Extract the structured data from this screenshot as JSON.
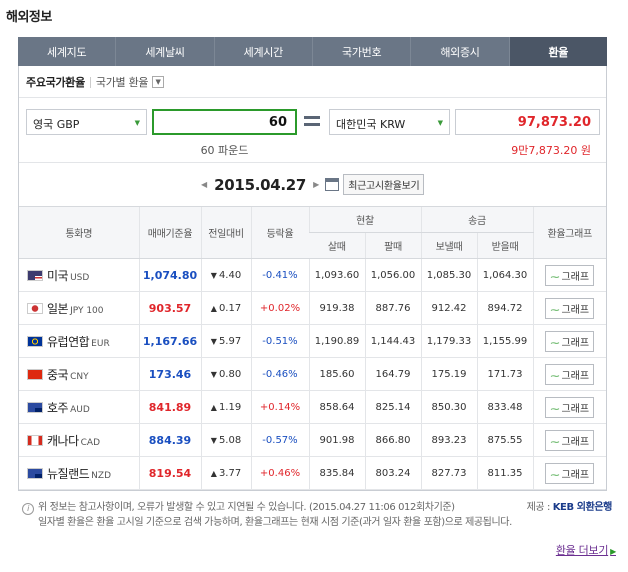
{
  "section_title": "해외정보",
  "tabs": [
    {
      "label": "세계지도",
      "active": false
    },
    {
      "label": "세계날씨",
      "active": false
    },
    {
      "label": "세계시간",
      "active": false
    },
    {
      "label": "국가번호",
      "active": false
    },
    {
      "label": "해외증시",
      "active": false
    },
    {
      "label": "환율",
      "active": true
    }
  ],
  "subtabs": {
    "main": "주요국가환율",
    "other": "국가별 환율"
  },
  "converter": {
    "from_currency": "영국 GBP",
    "amount": "60",
    "from_caption": "60 파운드",
    "to_currency": "대한민국 KRW",
    "result": "97,873.20",
    "result_caption": "9만7,873.20 원"
  },
  "date_nav": {
    "date": "2015.04.27",
    "latest_button": "최근고시환율보기"
  },
  "table": {
    "headers": {
      "currency": "통화명",
      "base_rate": "매매기준율",
      "prev_change": "전일대비",
      "change_rate": "등락율",
      "cash": "현찰",
      "cash_buy": "살때",
      "cash_sell": "팔때",
      "remit": "송금",
      "remit_send": "보낼때",
      "remit_receive": "받을때",
      "graph": "환율그래프"
    },
    "graph_label": "그래프",
    "rows": [
      {
        "flag": "us",
        "name": "미국",
        "code": "USD",
        "base": "1,074.80",
        "dir": "down",
        "change": "4.40",
        "rate": "-0.41%",
        "cash_buy": "1,093.60",
        "cash_sell": "1,056.00",
        "send": "1,085.30",
        "receive": "1,064.30"
      },
      {
        "flag": "jp",
        "name": "일본",
        "code": "JPY 100",
        "base": "903.57",
        "dir": "up",
        "change": "0.17",
        "rate": "+0.02%",
        "cash_buy": "919.38",
        "cash_sell": "887.76",
        "send": "912.42",
        "receive": "894.72"
      },
      {
        "flag": "eu",
        "name": "유럽연합",
        "code": "EUR",
        "base": "1,167.66",
        "dir": "down",
        "change": "5.97",
        "rate": "-0.51%",
        "cash_buy": "1,190.89",
        "cash_sell": "1,144.43",
        "send": "1,179.33",
        "receive": "1,155.99"
      },
      {
        "flag": "cn",
        "name": "중국",
        "code": "CNY",
        "base": "173.46",
        "dir": "down",
        "change": "0.80",
        "rate": "-0.46%",
        "cash_buy": "185.60",
        "cash_sell": "164.79",
        "send": "175.19",
        "receive": "171.73"
      },
      {
        "flag": "au",
        "name": "호주",
        "code": "AUD",
        "base": "841.89",
        "dir": "up",
        "change": "1.19",
        "rate": "+0.14%",
        "cash_buy": "858.64",
        "cash_sell": "825.14",
        "send": "850.30",
        "receive": "833.48"
      },
      {
        "flag": "ca",
        "name": "캐나다",
        "code": "CAD",
        "base": "884.39",
        "dir": "down",
        "change": "5.08",
        "rate": "-0.57%",
        "cash_buy": "901.98",
        "cash_sell": "866.80",
        "send": "893.23",
        "receive": "875.55"
      },
      {
        "flag": "nz",
        "name": "뉴질랜드",
        "code": "NZD",
        "base": "819.54",
        "dir": "up",
        "change": "3.77",
        "rate": "+0.46%",
        "cash_buy": "835.84",
        "cash_sell": "803.24",
        "send": "827.73",
        "receive": "811.35"
      }
    ]
  },
  "notes": {
    "line1": "위 정보는 참고사항이며, 오류가 발생할 수 있고 지연될 수 있습니다. (2015.04.27 11:06 012회차기준)",
    "provider_label": "제공 :",
    "provider_name": "KEB 외환은행",
    "line2": "일자별 환율은 환율 고시일 기준으로 검색 가능하며, 환율그래프는 현재 시점 기준(과거 일자 환율 포함)으로 제공됩니다."
  },
  "more_link": "환율 더보기",
  "colors": {
    "tab_bg": "#6a7686",
    "tab_active": "#4b5666",
    "up": "#e0262b",
    "down": "#1a4fc0",
    "accent_green": "#2b9a2b"
  }
}
